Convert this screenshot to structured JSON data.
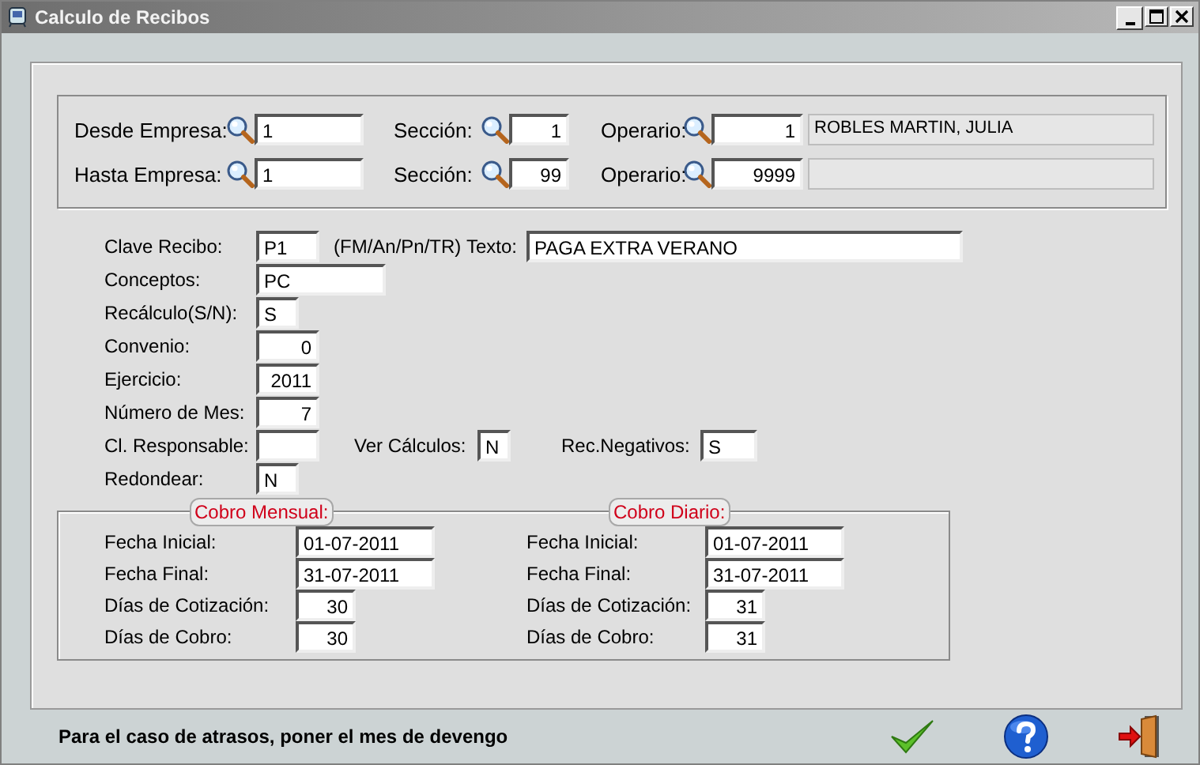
{
  "window": {
    "title": "Calculo de Recibos"
  },
  "range": [
    {
      "empresa_label": "Desde Empresa:",
      "empresa": "1",
      "seccion_label": "Sección:",
      "seccion": "1",
      "operario_label": "Operario:",
      "operario": "1",
      "operario_name": "ROBLES MARTIN, JULIA"
    },
    {
      "empresa_label": "Hasta Empresa:",
      "empresa": "1",
      "seccion_label": "Sección:",
      "seccion": "99",
      "operario_label": "Operario:",
      "operario": "9999"
    }
  ],
  "params": [
    {
      "fields": [
        {
          "label": "Clave Recibo:",
          "value": "P1"
        },
        {
          "label": "Texto:",
          "value": "PAGA EXTRA VERANO"
        }
      ],
      "hint": "(FM/An/Pn/TR)"
    },
    {
      "fields": [
        {
          "label": "Conceptos:",
          "value": "PC"
        }
      ]
    },
    {
      "fields": [
        {
          "label": "Recálculo(S/N):",
          "value": "S"
        }
      ]
    },
    {
      "fields": [
        {
          "label": "Convenio:",
          "value": "0"
        }
      ]
    },
    {
      "fields": [
        {
          "label": "Ejercicio:",
          "value": "2011"
        }
      ]
    },
    {
      "fields": [
        {
          "label": "Número de Mes:",
          "value": "7"
        }
      ]
    },
    {
      "fields": [
        {
          "label": "Cl. Responsable:"
        },
        {
          "label": "Ver Cálculos:",
          "value": "N"
        },
        {
          "label": "Rec.Negativos:",
          "value": "S"
        }
      ]
    },
    {
      "fields": [
        {
          "label": "Redondear:",
          "value": "N"
        }
      ]
    }
  ],
  "groups": [
    {
      "title": "Cobro Mensual:",
      "fields": [
        {
          "label": "Fecha Inicial:",
          "value": "01-07-2011"
        },
        {
          "label": "Fecha Final:",
          "value": "31-07-2011"
        },
        {
          "label": "Días de Cotización:",
          "value": "30"
        },
        {
          "label": "Días de Cobro:",
          "value": "30"
        }
      ]
    },
    {
      "title": "Cobro Diario:",
      "fields": [
        {
          "label": "Fecha Inicial:",
          "value": "01-07-2011"
        },
        {
          "label": "Fecha Final:",
          "value": "31-07-2011"
        },
        {
          "label": "Días de Cotización:",
          "value": "31"
        },
        {
          "label": "Días de Cobro:",
          "value": "31"
        }
      ]
    }
  ],
  "status": "Para el caso de atrasos, poner el mes de devengo"
}
